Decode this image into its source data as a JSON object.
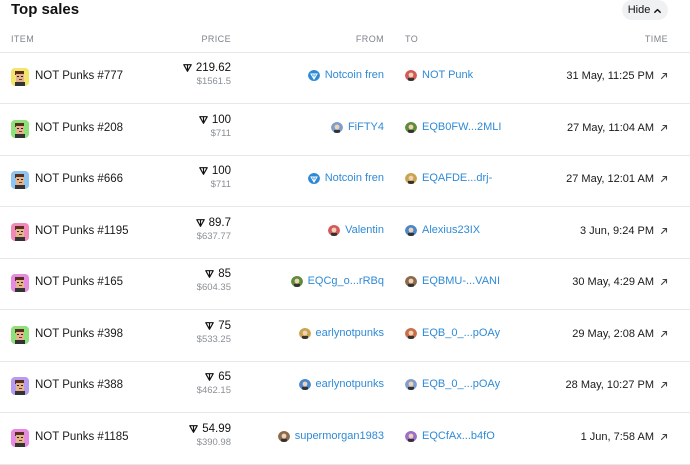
{
  "header": {
    "title": "Top sales",
    "hide_label": "Hide"
  },
  "columns": {
    "item": "ITEM",
    "price": "PRICE",
    "from": "FROM",
    "to": "TO",
    "time": "TIME"
  },
  "colors": {
    "link": "#2f8ad6",
    "muted": "#8a9097",
    "divider": "#e6e8eb"
  },
  "rows": [
    {
      "item": "NOT Punks #777",
      "item_bg": "#f3e46b",
      "ton": "219.62",
      "usd": "$1561.5",
      "from": "Notcoin fren",
      "from_icon": "notcoin-icon",
      "to": "NOT Punk",
      "to_icon": "punk-avatar-icon",
      "time": "31 May, 11:25 PM"
    },
    {
      "item": "NOT Punks #208",
      "item_bg": "#8ee07a",
      "ton": "100",
      "usd": "$711",
      "from": "FiFTY4",
      "from_icon": "avatar-icon",
      "to": "EQB0FW...2MLI",
      "to_icon": "avatar-icon",
      "time": "27 May, 11:04 AM"
    },
    {
      "item": "NOT Punks #666",
      "item_bg": "#8ec4f0",
      "ton": "100",
      "usd": "$711",
      "from": "Notcoin fren",
      "from_icon": "notcoin-icon",
      "to": "EQAFDE...drj-",
      "to_icon": "avatar-icon",
      "time": "27 May, 12:01 AM"
    },
    {
      "item": "NOT Punks #1195",
      "item_bg": "#f08ab8",
      "ton": "89.7",
      "usd": "$637.77",
      "from": "Valentin",
      "from_icon": "avatar-icon",
      "to": "Alexius23IX",
      "to_icon": "avatar-icon",
      "time": "3 Jun, 9:24 PM"
    },
    {
      "item": "NOT Punks #165",
      "item_bg": "#e58ce0",
      "ton": "85",
      "usd": "$604.35",
      "from": "EQCg_o...rRBq",
      "from_icon": "avatar-icon",
      "to": "EQBMU-...VANI",
      "to_icon": "avatar-icon",
      "time": "30 May, 4:29 AM"
    },
    {
      "item": "NOT Punks #398",
      "item_bg": "#8ee07a",
      "ton": "75",
      "usd": "$533.25",
      "from": "earlynotpunks",
      "from_icon": "avatar-icon",
      "to": "EQB_0_...pOAy",
      "to_icon": "avatar-icon",
      "time": "29 May, 2:08 AM"
    },
    {
      "item": "NOT Punks #388",
      "item_bg": "#b59cf0",
      "ton": "65",
      "usd": "$462.15",
      "from": "earlynotpunks",
      "from_icon": "avatar-icon",
      "to": "EQB_0_...pOAy",
      "to_icon": "avatar-icon",
      "time": "28 May, 10:27 PM"
    },
    {
      "item": "NOT Punks #1185",
      "item_bg": "#e58ce0",
      "ton": "54.99",
      "usd": "$390.98",
      "from": "supermorgan1983",
      "from_icon": "avatar-icon",
      "to": "EQCfAx...b4fO",
      "to_icon": "avatar-icon",
      "time": "1 Jun, 7:58 AM"
    }
  ]
}
